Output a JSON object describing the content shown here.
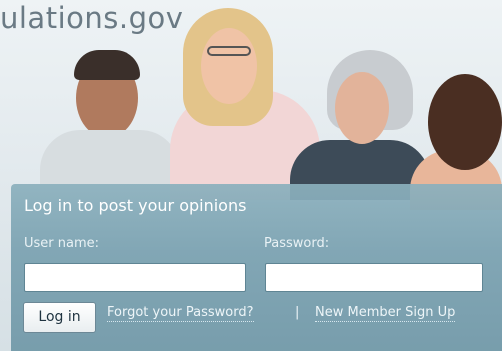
{
  "brand": {
    "text": "ulations.gov"
  },
  "login": {
    "title": "Log in to post your opinions",
    "username_label": "User name:",
    "password_label": "Password:",
    "username_value": "",
    "password_value": "",
    "login_button": "Log in",
    "forgot_link": "Forgot your Password?",
    "separator": "|",
    "signup_link": "New Member Sign Up"
  },
  "colors": {
    "panel": "#8bb0bd",
    "brand_text": "#6a7a84"
  }
}
